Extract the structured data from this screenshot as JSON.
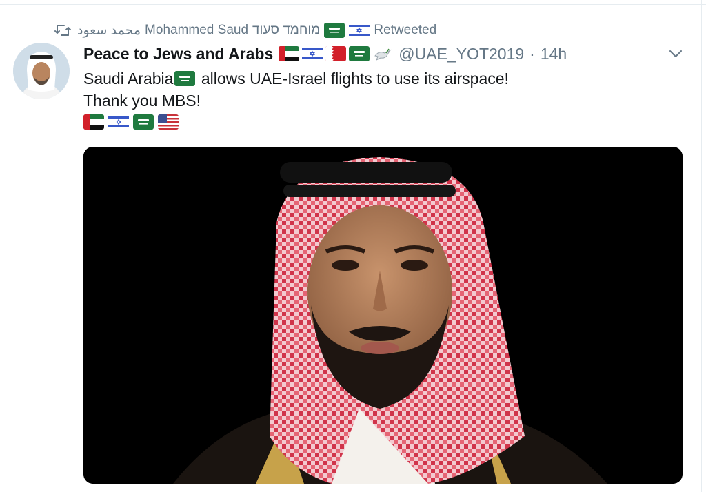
{
  "retweet": {
    "icon": "retweet-icon",
    "name_arabic": "محمد سعود",
    "name_latin": "Mohammed Saud",
    "name_hebrew": "מוחמד סעוד",
    "flags": [
      "flag-saudi-arabia",
      "flag-israel"
    ],
    "suffix": "Retweeted"
  },
  "tweet": {
    "author": {
      "display_name": "Peace to Jews and Arabs",
      "name_flags": [
        "flag-uae",
        "flag-israel",
        "flag-bahrain",
        "flag-saudi-arabia",
        "dove-icon"
      ],
      "handle": "@UAE_YOT2019",
      "separator": "·",
      "time": "14h"
    },
    "text": {
      "line1_a": "Saudi Arabia",
      "line1_flag": "flag-saudi-arabia",
      "line1_b": " allows UAE-Israel flights to use its airspace!",
      "line2": "Thank you MBS!",
      "line3_flags": [
        "flag-uae",
        "flag-israel",
        "flag-saudi-arabia",
        "flag-usa"
      ]
    },
    "menu_icon": "chevron-down-icon",
    "media": {
      "type": "photo",
      "subject": "portrait"
    }
  },
  "colors": {
    "text": "#14171a",
    "secondary": "#657786",
    "divider": "#e6ecf0",
    "media_bg": "#000000"
  }
}
